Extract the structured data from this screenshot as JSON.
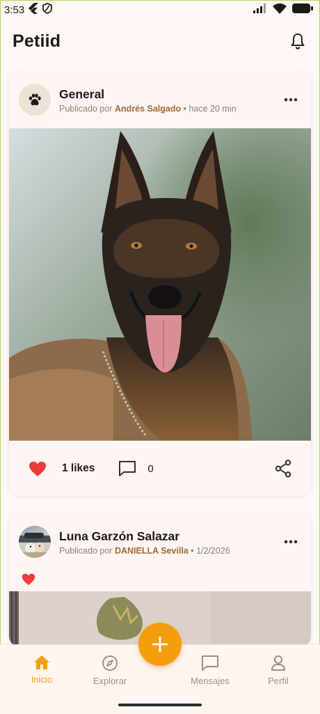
{
  "status_bar": {
    "time": "3:53",
    "icons": [
      "flutter-icon",
      "shield-icon",
      "signal-icon",
      "wifi-icon",
      "battery-icon"
    ]
  },
  "header": {
    "title": "Petiid",
    "notification_icon": "bell-icon"
  },
  "posts": [
    {
      "title": "General",
      "avatar_icon": "paw-icon",
      "meta_prefix": "Publicado por",
      "author": "Andrés  Salgado",
      "meta_suffix": "• hace 20 min",
      "image": "dog-photo",
      "likes_label": "1 likes",
      "comments_count": "0",
      "liked": true
    },
    {
      "title": "Luna Garzón Salazar",
      "avatar_icon": "user-photo",
      "meta_prefix": "Publicado por",
      "author": "DANIELLA  Sevilla",
      "meta_suffix": "• 1/2/2026",
      "liked": true
    }
  ],
  "bottom_nav": {
    "items": [
      {
        "label": "Inicio",
        "icon": "home-icon",
        "active": true
      },
      {
        "label": "Explorar",
        "icon": "compass-icon",
        "active": false
      },
      {
        "label": "Mensajes",
        "icon": "message-icon",
        "active": false
      },
      {
        "label": "Perfil",
        "icon": "person-icon",
        "active": false
      }
    ],
    "fab_icon": "plus-icon"
  },
  "colors": {
    "accent": "#f59e0b",
    "author": "#a06b33",
    "like": "#ef3b3b",
    "background": "#fff7f4"
  }
}
